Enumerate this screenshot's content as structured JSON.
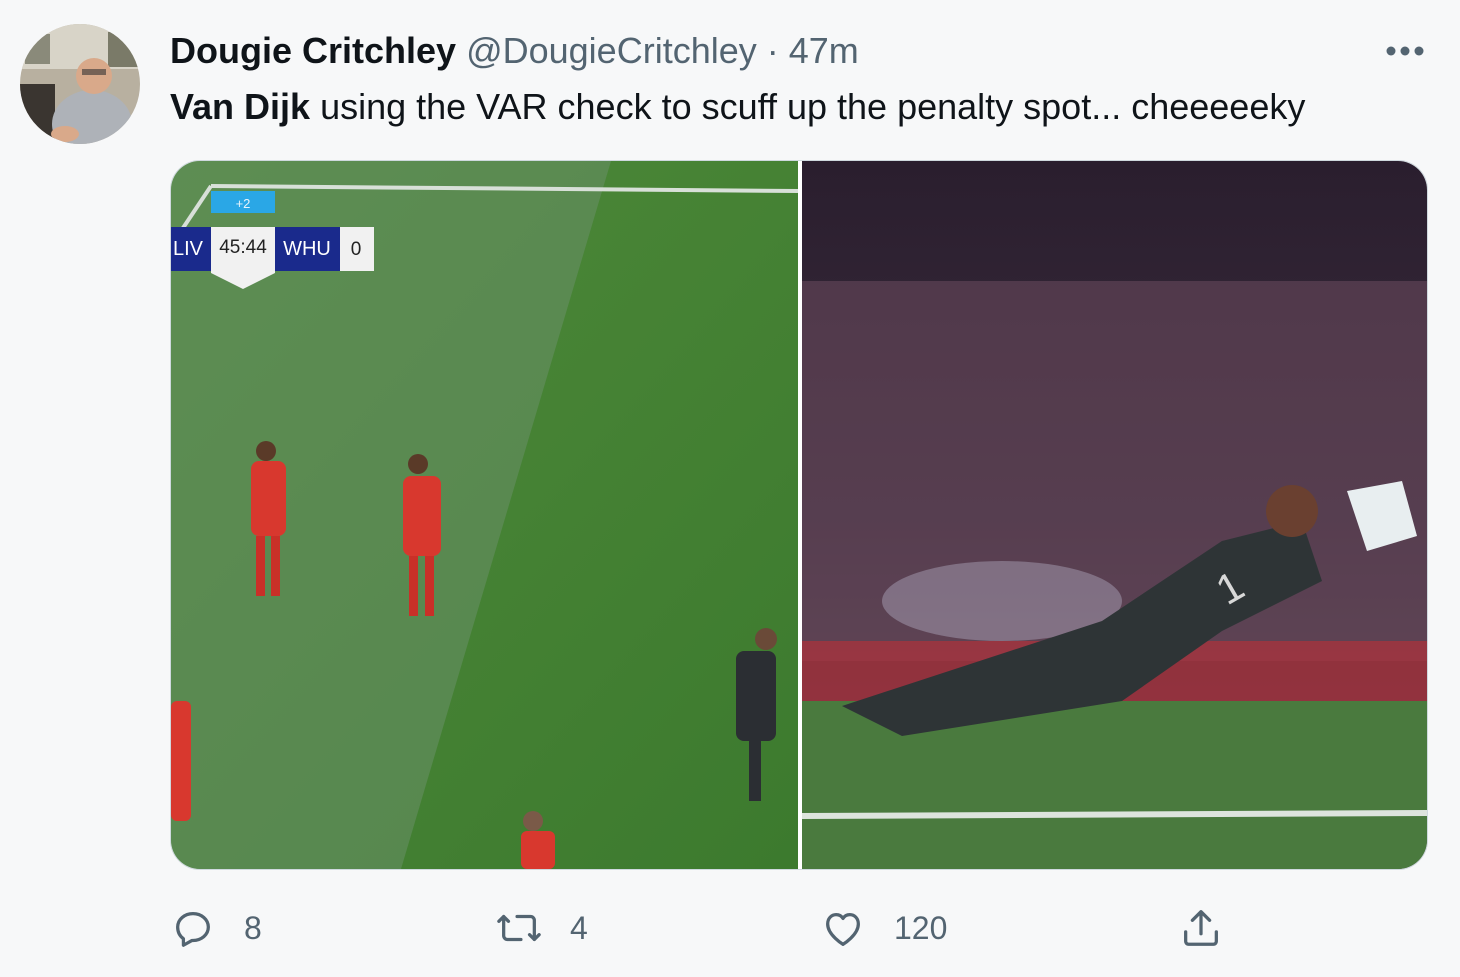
{
  "tweet": {
    "author_name": "Dougie Critchley",
    "author_handle": "@DougieCritchley",
    "separator": "·",
    "timestamp": "47m",
    "text_bold": "Van Dijk",
    "text_rest": " using the VAR check to scuff up the penalty spot... cheeeeeky"
  },
  "scorebug": {
    "added_time": "+2",
    "home": "LIV",
    "clock": "45:44",
    "away": "WHU",
    "away_score": "0"
  },
  "actions": {
    "reply_count": "8",
    "retweet_count": "4",
    "like_count": "120"
  },
  "colors": {
    "text": "#0f1419",
    "secondary": "#536471",
    "background": "#f7f8f9"
  },
  "icons": [
    "more-icon",
    "reply-icon",
    "retweet-icon",
    "like-icon",
    "share-icon"
  ]
}
